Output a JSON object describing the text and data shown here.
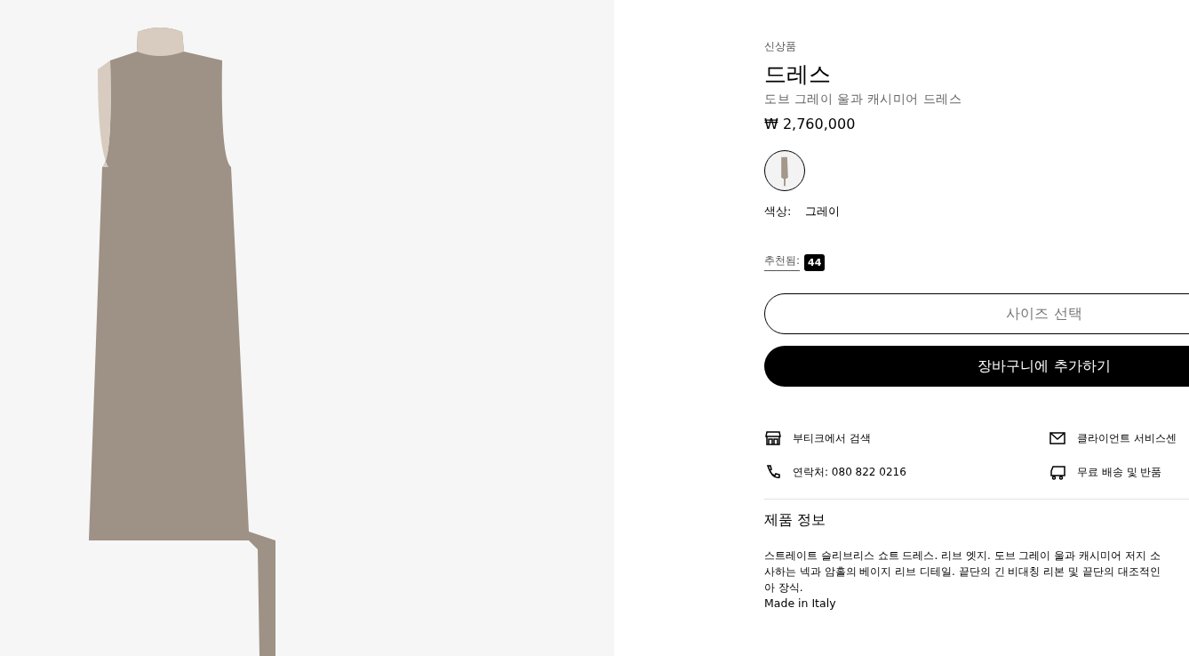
{
  "product": {
    "tag": "신상품",
    "title": "드레스",
    "subtitle": "도브 그레이 울과 캐시미어 드레스",
    "price": "₩ 2,760,000"
  },
  "color_swatches": [
    {
      "selected": true
    }
  ],
  "color": {
    "label": "색상:",
    "value": "그레이"
  },
  "recommended": {
    "label": "추천됨:",
    "count": "44"
  },
  "size_select": {
    "placeholder": "사이즈 선택"
  },
  "add_to_cart": "장바구니에 추가하기",
  "services": [
    {
      "kind": "store",
      "label": "부티크에서 검색"
    },
    {
      "kind": "mail",
      "label": "클라이언트 서비스센"
    },
    {
      "kind": "phone",
      "label": "연락처: 080 822 0216"
    },
    {
      "kind": "truck",
      "label": "무료 배송 및 반품"
    }
  ],
  "product_info": {
    "heading": "제품 정보",
    "description_lines": [
      "스트레이트 슬리브리스 쇼트 드레스. 리브 엣지. 도브 그레이 울과 캐시미어 저지 소",
      "사하는 넥과 암홀의 베이지 리브 디테일. 끝단의 긴 비대칭 리본 및 끝단의 대조적인",
      "아 장식."
    ],
    "origin": "Made in Italy"
  }
}
